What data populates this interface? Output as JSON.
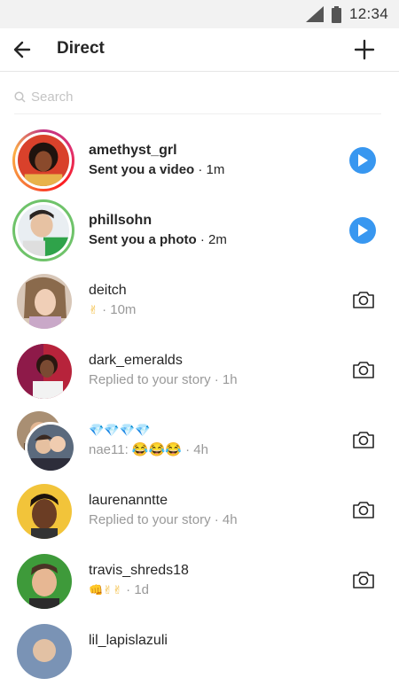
{
  "status_bar": {
    "time": "12:34"
  },
  "header": {
    "title": "Direct"
  },
  "search": {
    "placeholder": "Search"
  },
  "threads": [
    {
      "username": "amethyst_grl",
      "subtitle": "Sent you a video",
      "time": "· 1m",
      "unread": true,
      "action": "play"
    },
    {
      "username": "phillsohn",
      "subtitle": "Sent you a photo",
      "time": "· 2m",
      "unread": true,
      "action": "play"
    },
    {
      "username": "deitch",
      "subtitle": "✌",
      "time": "· 10m",
      "unread": false,
      "action": "camera"
    },
    {
      "username": "dark_emeralds",
      "subtitle": "Replied to your story",
      "time": "· 1h",
      "unread": false,
      "action": "camera"
    },
    {
      "username": "💎💎💎💎",
      "subtitle": "nae11: 😂😂😂",
      "time": "· 4h",
      "unread": false,
      "action": "camera"
    },
    {
      "username": "laurenanntte",
      "subtitle": "Replied to your story",
      "time": "· 4h",
      "unread": false,
      "action": "camera"
    },
    {
      "username": "travis_shreds18",
      "subtitle": "👊✌✌",
      "time": "· 1d",
      "unread": false,
      "action": "camera"
    },
    {
      "username": "lil_lapislazuli",
      "subtitle": "",
      "time": "",
      "unread": false,
      "action": "camera"
    }
  ],
  "colors": {
    "accent": "#3897f0",
    "story_ring": "#e1306c",
    "seen_ring": "#6fc36a"
  }
}
